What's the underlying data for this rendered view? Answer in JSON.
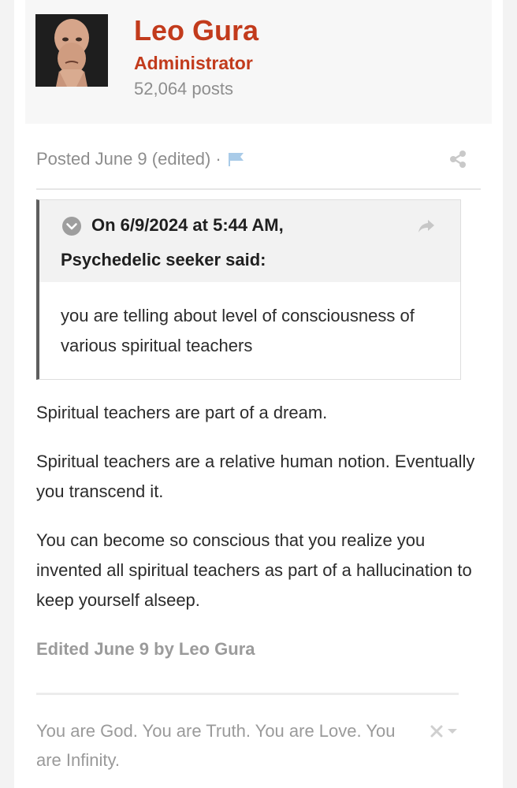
{
  "author": {
    "name": "Leo Gura",
    "role": "Administrator",
    "post_count": "52,064 posts"
  },
  "post": {
    "posted_label": "Posted June 9 (edited)",
    "separator": "·",
    "icons": {
      "flag": "flag-icon",
      "share": "share-icon"
    }
  },
  "quote": {
    "header_line1": "On 6/9/2024 at 5:44 AM,",
    "header_line2": "Psychedelic seeker said:",
    "body": "you are telling about level of consciousness of various spiritual teachers",
    "icons": {
      "toggle": "chevron-down-circle-icon",
      "jump": "share-arrow-icon"
    }
  },
  "body": {
    "paragraphs": [
      "Spiritual teachers are part of a dream.",
      "Spiritual teachers are a relative human notion. Eventually you transcend it.",
      "You can become so conscious that you realize you invented all spiritual teachers as part of a hallucination to keep yourself alseep."
    ]
  },
  "edited_note": "Edited June 9 by Leo Gura",
  "signature": {
    "text": "You are God. You are Truth. You are Love. You are Infinity."
  },
  "colors": {
    "brand": "#c23b1c",
    "muted_text": "#8d8d8d",
    "flag_blue": "#a9cbe8"
  }
}
